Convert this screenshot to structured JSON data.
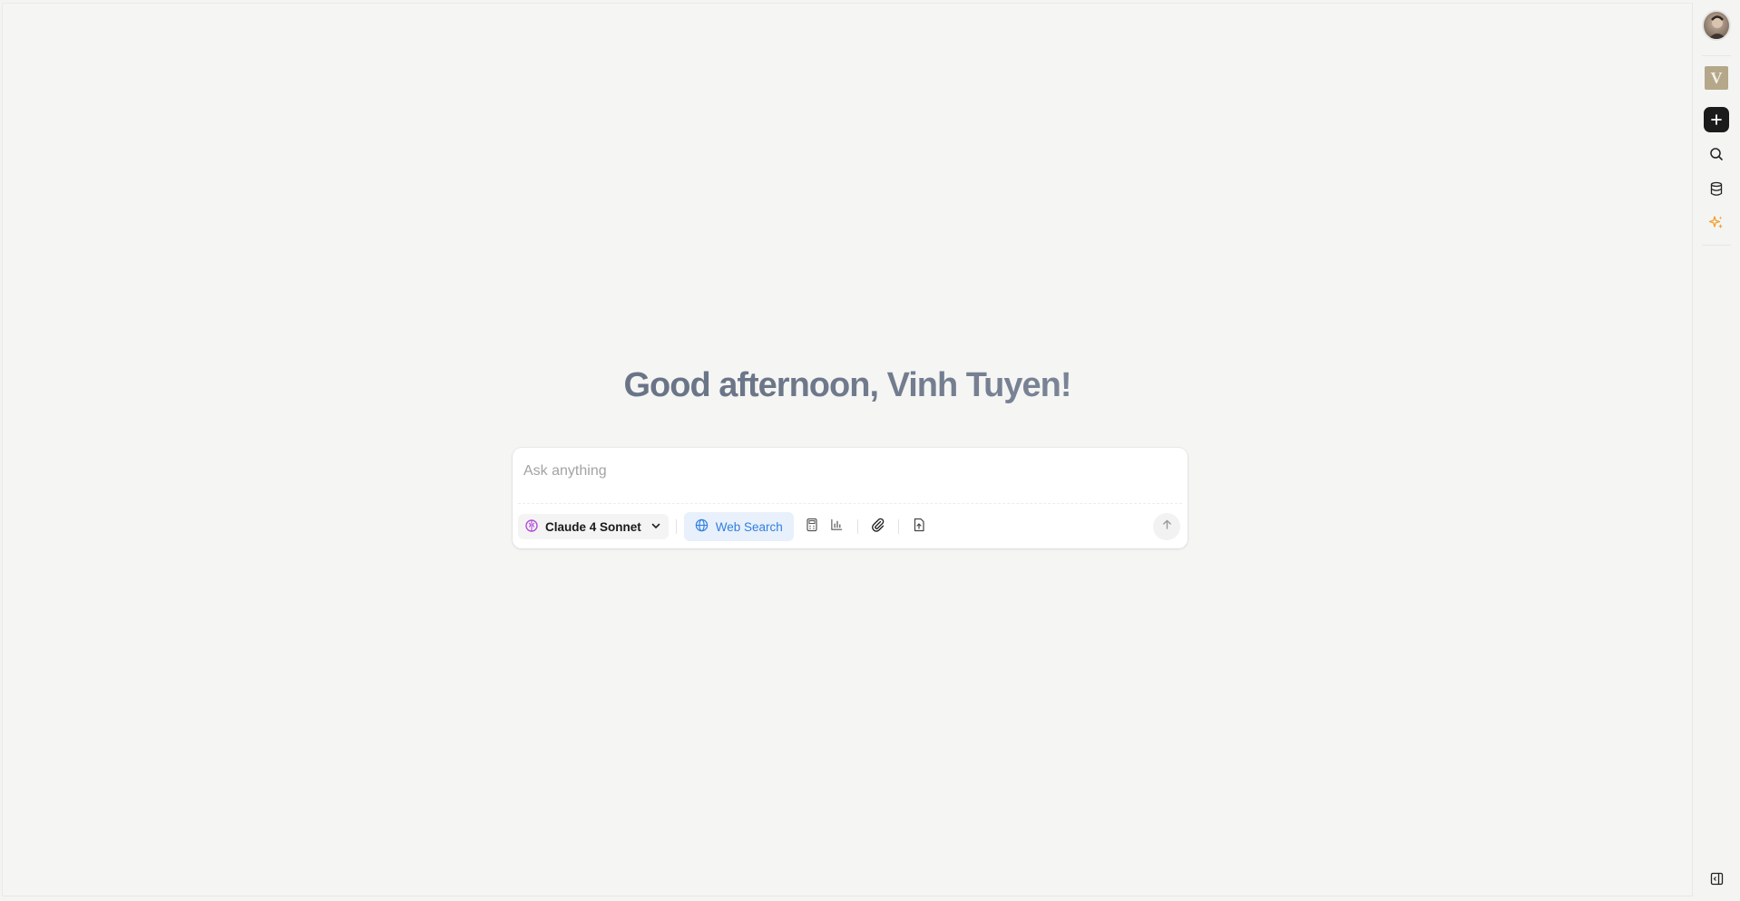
{
  "greeting": "Good afternoon, Vinh Tuyen!",
  "composer": {
    "placeholder": "Ask anything",
    "model_label": "Claude 4 Sonnet",
    "web_search_label": "Web Search"
  },
  "rail": {
    "workspace_initial": "V"
  },
  "colors": {
    "background": "#f5f5f3",
    "accent_blue": "#2f7fe0",
    "new_chat_bg": "#1b1b1b",
    "sparkle": "#f0a030",
    "model_icon": "#b04fd8"
  },
  "icons": {
    "model": "brain-icon",
    "model_dropdown": "chevron-down-icon",
    "web_search": "globe-icon",
    "calculator": "calculator-icon",
    "chart": "bar-chart-icon",
    "attach": "paperclip-icon",
    "upload_file": "file-upload-icon",
    "send": "arrow-up-icon",
    "new_chat": "plus-icon",
    "search": "search-icon",
    "database": "database-icon",
    "sparkle": "sparkle-icon",
    "panel_toggle": "panel-toggle-icon"
  }
}
